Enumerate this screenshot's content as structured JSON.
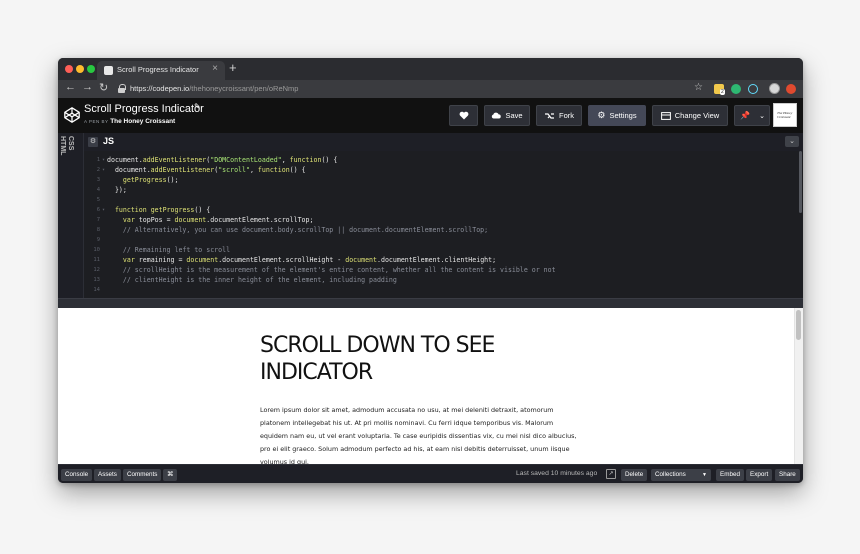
{
  "browser": {
    "tab_title": "Scroll Progress Indicator",
    "tab_close": "×",
    "new_tab": "+",
    "url_host": "https://codepen.io",
    "url_path": "/thehoneycroissant/pen/oReNmp",
    "ext_badge": "2"
  },
  "header": {
    "pen_title": "Scroll Progress Indicator",
    "by_label": "A PEN BY",
    "author": "The Honey Croissant",
    "buttons": {
      "save": "Save",
      "fork": "Fork",
      "settings": "Settings",
      "change_view": "Change View"
    },
    "profile_text": "The Honey Croissant"
  },
  "editor": {
    "side_tabs": [
      "CSS",
      "HTML"
    ],
    "panel_title": "JS",
    "lines": [
      {
        "n": "1",
        "fold": "▾",
        "parts": [
          [
            "",
            "document."
          ],
          [
            "f",
            "addEventListener"
          ],
          [
            "",
            "("
          ],
          [
            "s",
            "\"DOMContentLoaded\""
          ],
          [
            "",
            ", "
          ],
          [
            "k",
            "function"
          ],
          [
            "",
            "() {"
          ]
        ]
      },
      {
        "n": "2",
        "fold": "▾",
        "parts": [
          [
            "",
            "  document."
          ],
          [
            "f",
            "addEventListener"
          ],
          [
            "",
            "("
          ],
          [
            "s",
            "\"scroll\""
          ],
          [
            "",
            ", "
          ],
          [
            "k",
            "function"
          ],
          [
            "",
            "() {"
          ]
        ]
      },
      {
        "n": "3",
        "fold": "",
        "parts": [
          [
            "",
            "    "
          ],
          [
            "f",
            "getProgress"
          ],
          [
            "",
            "();"
          ]
        ]
      },
      {
        "n": "4",
        "fold": "",
        "parts": [
          [
            "",
            "  });"
          ]
        ]
      },
      {
        "n": "5",
        "fold": "",
        "parts": [
          [
            "",
            ""
          ]
        ]
      },
      {
        "n": "6",
        "fold": "▾",
        "parts": [
          [
            "",
            "  "
          ],
          [
            "k",
            "function"
          ],
          [
            "",
            ""
          ],
          [
            "f",
            " getProgress"
          ],
          [
            "",
            "() {"
          ]
        ]
      },
      {
        "n": "7",
        "fold": "",
        "parts": [
          [
            "",
            "    "
          ],
          [
            "k",
            "var"
          ],
          [
            "",
            " topPos = "
          ],
          [
            "f",
            "document"
          ],
          [
            "",
            ".documentElement.scrollTop;"
          ]
        ]
      },
      {
        "n": "8",
        "fold": "",
        "parts": [
          [
            "c",
            "    // Alternatively, you can use document.body.scrollTop || document.documentElement.scrollTop;"
          ]
        ]
      },
      {
        "n": "9",
        "fold": "",
        "parts": [
          [
            "",
            ""
          ]
        ]
      },
      {
        "n": "10",
        "fold": "",
        "parts": [
          [
            "c",
            "    // Remaining left to scroll"
          ]
        ]
      },
      {
        "n": "11",
        "fold": "",
        "parts": [
          [
            "",
            "    "
          ],
          [
            "k",
            "var"
          ],
          [
            "",
            " remaining = "
          ],
          [
            "f",
            "document"
          ],
          [
            "",
            ".documentElement.scrollHeight - "
          ],
          [
            "f",
            "document"
          ],
          [
            "",
            ".documentElement.clientHeight;"
          ]
        ]
      },
      {
        "n": "12",
        "fold": "",
        "parts": [
          [
            "c",
            "    // scrollHeight is the measurement of the element's entire content, whether all the content is visible or not"
          ]
        ]
      },
      {
        "n": "13",
        "fold": "",
        "parts": [
          [
            "c",
            "    // clientHeight is the inner height of the element, including padding"
          ]
        ]
      },
      {
        "n": "14",
        "fold": "",
        "parts": [
          [
            "",
            ""
          ]
        ]
      }
    ]
  },
  "preview": {
    "heading": "SCROLL DOWN TO SEE INDICATOR",
    "body": "Lorem ipsum dolor sit amet, admodum accusata no usu, at mei deleniti detraxit, atomorum platonem intellegebat his ut. At pri mollis nominavi. Cu ferri idque temporibus vis. Malorum equidem nam eu, ut vel erant voluptaria. Te case euripidis dissentias vix, cu mei nisl dico albucius, pro ei elit graeco. Solum admodum perfecto ad his, at eam nisl debitis deterruisset, unum iisque volumus id qui."
  },
  "footer": {
    "console": "Console",
    "assets": "Assets",
    "comments": "Comments",
    "shortcuts": "⌘",
    "last_saved": "Last saved 10 minutes ago",
    "delete": "Delete",
    "collections": "Collections",
    "embed": "Embed",
    "export": "Export",
    "share": "Share"
  },
  "colors": {
    "header_bg": "#111111",
    "editor_bg": "#1d1e22",
    "keyword": "#dde175",
    "string": "#a8e475",
    "comment": "#8a8e99"
  }
}
